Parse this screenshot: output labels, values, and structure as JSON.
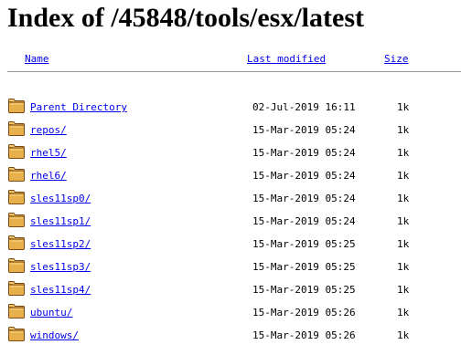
{
  "page": {
    "title": "Index of /45848/tools/esx/latest"
  },
  "columns": {
    "name": "Name",
    "last_modified": "Last modified",
    "size": "Size"
  },
  "entries": [
    {
      "icon": "folder-icon",
      "name": "Parent Directory",
      "modified": "02-Jul-2019 16:11",
      "size": "1k"
    },
    {
      "icon": "folder-icon",
      "name": "repos/",
      "modified": "15-Mar-2019 05:24",
      "size": "1k"
    },
    {
      "icon": "folder-icon",
      "name": "rhel5/",
      "modified": "15-Mar-2019 05:24",
      "size": "1k"
    },
    {
      "icon": "folder-icon",
      "name": "rhel6/",
      "modified": "15-Mar-2019 05:24",
      "size": "1k"
    },
    {
      "icon": "folder-icon",
      "name": "sles11sp0/",
      "modified": "15-Mar-2019 05:24",
      "size": "1k"
    },
    {
      "icon": "folder-icon",
      "name": "sles11sp1/",
      "modified": "15-Mar-2019 05:24",
      "size": "1k"
    },
    {
      "icon": "folder-icon",
      "name": "sles11sp2/",
      "modified": "15-Mar-2019 05:25",
      "size": "1k"
    },
    {
      "icon": "folder-icon",
      "name": "sles11sp3/",
      "modified": "15-Mar-2019 05:25",
      "size": "1k"
    },
    {
      "icon": "folder-icon",
      "name": "sles11sp4/",
      "modified": "15-Mar-2019 05:25",
      "size": "1k"
    },
    {
      "icon": "folder-icon",
      "name": "ubuntu/",
      "modified": "15-Mar-2019 05:26",
      "size": "1k"
    },
    {
      "icon": "folder-icon",
      "name": "windows/",
      "modified": "15-Mar-2019 05:26",
      "size": "1k"
    }
  ],
  "colors": {
    "link": "#0000ee",
    "folder_fill": "#e8b04a",
    "folder_outline": "#7a4a10"
  }
}
